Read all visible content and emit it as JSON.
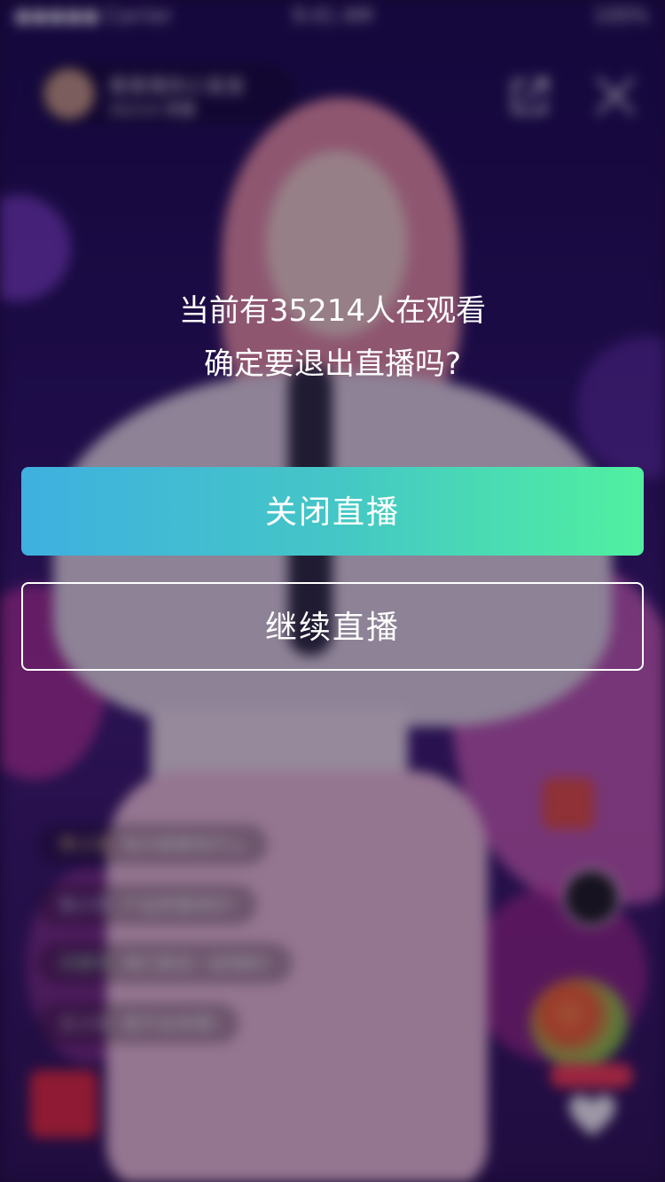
{
  "status_bar": {
    "carrier": "●●●●● Carrier ",
    "time": "9:41 AM",
    "battery": "100%"
  },
  "host": {
    "name": "青青青的小发发",
    "viewers": "35214 观看"
  },
  "chat": [
    {
      "user": "李小花",
      "text": "每天都要很开心"
    },
    {
      "user": "张小花",
      "text": "产品质量很好!"
    },
    {
      "user": "刘德华",
      "text": "我们是走一起嗨的!"
    },
    {
      "user": "王小花",
      "text": "我不会来唱!"
    }
  ],
  "dialog": {
    "line1": "当前有35214人在观看",
    "line2": "确定要退出直播吗?",
    "confirm_label": "关闭直播",
    "cancel_label": "继续直播"
  },
  "colors": {
    "gradient_start": "#3fb0e0",
    "gradient_end": "#50f0a0"
  }
}
